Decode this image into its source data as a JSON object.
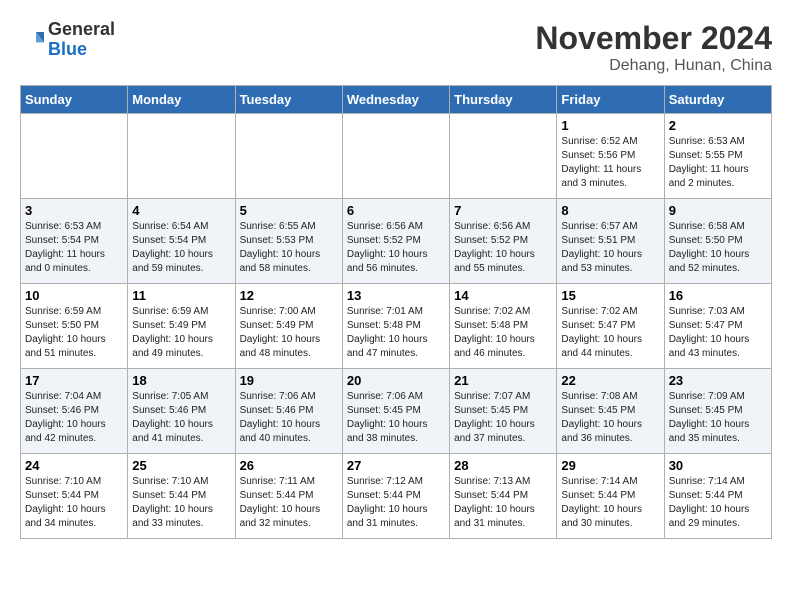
{
  "header": {
    "logo_line1": "General",
    "logo_line2": "Blue",
    "month_title": "November 2024",
    "location": "Dehang, Hunan, China"
  },
  "days_of_week": [
    "Sunday",
    "Monday",
    "Tuesday",
    "Wednesday",
    "Thursday",
    "Friday",
    "Saturday"
  ],
  "weeks": [
    [
      {
        "day": "",
        "info": ""
      },
      {
        "day": "",
        "info": ""
      },
      {
        "day": "",
        "info": ""
      },
      {
        "day": "",
        "info": ""
      },
      {
        "day": "",
        "info": ""
      },
      {
        "day": "1",
        "info": "Sunrise: 6:52 AM\nSunset: 5:56 PM\nDaylight: 11 hours and 3 minutes."
      },
      {
        "day": "2",
        "info": "Sunrise: 6:53 AM\nSunset: 5:55 PM\nDaylight: 11 hours and 2 minutes."
      }
    ],
    [
      {
        "day": "3",
        "info": "Sunrise: 6:53 AM\nSunset: 5:54 PM\nDaylight: 11 hours and 0 minutes."
      },
      {
        "day": "4",
        "info": "Sunrise: 6:54 AM\nSunset: 5:54 PM\nDaylight: 10 hours and 59 minutes."
      },
      {
        "day": "5",
        "info": "Sunrise: 6:55 AM\nSunset: 5:53 PM\nDaylight: 10 hours and 58 minutes."
      },
      {
        "day": "6",
        "info": "Sunrise: 6:56 AM\nSunset: 5:52 PM\nDaylight: 10 hours and 56 minutes."
      },
      {
        "day": "7",
        "info": "Sunrise: 6:56 AM\nSunset: 5:52 PM\nDaylight: 10 hours and 55 minutes."
      },
      {
        "day": "8",
        "info": "Sunrise: 6:57 AM\nSunset: 5:51 PM\nDaylight: 10 hours and 53 minutes."
      },
      {
        "day": "9",
        "info": "Sunrise: 6:58 AM\nSunset: 5:50 PM\nDaylight: 10 hours and 52 minutes."
      }
    ],
    [
      {
        "day": "10",
        "info": "Sunrise: 6:59 AM\nSunset: 5:50 PM\nDaylight: 10 hours and 51 minutes."
      },
      {
        "day": "11",
        "info": "Sunrise: 6:59 AM\nSunset: 5:49 PM\nDaylight: 10 hours and 49 minutes."
      },
      {
        "day": "12",
        "info": "Sunrise: 7:00 AM\nSunset: 5:49 PM\nDaylight: 10 hours and 48 minutes."
      },
      {
        "day": "13",
        "info": "Sunrise: 7:01 AM\nSunset: 5:48 PM\nDaylight: 10 hours and 47 minutes."
      },
      {
        "day": "14",
        "info": "Sunrise: 7:02 AM\nSunset: 5:48 PM\nDaylight: 10 hours and 46 minutes."
      },
      {
        "day": "15",
        "info": "Sunrise: 7:02 AM\nSunset: 5:47 PM\nDaylight: 10 hours and 44 minutes."
      },
      {
        "day": "16",
        "info": "Sunrise: 7:03 AM\nSunset: 5:47 PM\nDaylight: 10 hours and 43 minutes."
      }
    ],
    [
      {
        "day": "17",
        "info": "Sunrise: 7:04 AM\nSunset: 5:46 PM\nDaylight: 10 hours and 42 minutes."
      },
      {
        "day": "18",
        "info": "Sunrise: 7:05 AM\nSunset: 5:46 PM\nDaylight: 10 hours and 41 minutes."
      },
      {
        "day": "19",
        "info": "Sunrise: 7:06 AM\nSunset: 5:46 PM\nDaylight: 10 hours and 40 minutes."
      },
      {
        "day": "20",
        "info": "Sunrise: 7:06 AM\nSunset: 5:45 PM\nDaylight: 10 hours and 38 minutes."
      },
      {
        "day": "21",
        "info": "Sunrise: 7:07 AM\nSunset: 5:45 PM\nDaylight: 10 hours and 37 minutes."
      },
      {
        "day": "22",
        "info": "Sunrise: 7:08 AM\nSunset: 5:45 PM\nDaylight: 10 hours and 36 minutes."
      },
      {
        "day": "23",
        "info": "Sunrise: 7:09 AM\nSunset: 5:45 PM\nDaylight: 10 hours and 35 minutes."
      }
    ],
    [
      {
        "day": "24",
        "info": "Sunrise: 7:10 AM\nSunset: 5:44 PM\nDaylight: 10 hours and 34 minutes."
      },
      {
        "day": "25",
        "info": "Sunrise: 7:10 AM\nSunset: 5:44 PM\nDaylight: 10 hours and 33 minutes."
      },
      {
        "day": "26",
        "info": "Sunrise: 7:11 AM\nSunset: 5:44 PM\nDaylight: 10 hours and 32 minutes."
      },
      {
        "day": "27",
        "info": "Sunrise: 7:12 AM\nSunset: 5:44 PM\nDaylight: 10 hours and 31 minutes."
      },
      {
        "day": "28",
        "info": "Sunrise: 7:13 AM\nSunset: 5:44 PM\nDaylight: 10 hours and 31 minutes."
      },
      {
        "day": "29",
        "info": "Sunrise: 7:14 AM\nSunset: 5:44 PM\nDaylight: 10 hours and 30 minutes."
      },
      {
        "day": "30",
        "info": "Sunrise: 7:14 AM\nSunset: 5:44 PM\nDaylight: 10 hours and 29 minutes."
      }
    ]
  ]
}
